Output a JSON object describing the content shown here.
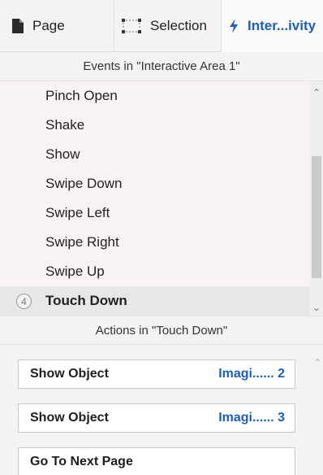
{
  "tabs": {
    "page": {
      "label": "Page",
      "icon": "page-icon"
    },
    "selection": {
      "label": "Selection",
      "icon": "selection-icon"
    },
    "interactivity": {
      "label": "Inter...ivity",
      "icon": "interactivity-icon",
      "active": true
    }
  },
  "events": {
    "header": "Events in \"Interactive Area 1\"",
    "items": [
      {
        "label": "Pinch Open"
      },
      {
        "label": "Shake"
      },
      {
        "label": "Show"
      },
      {
        "label": "Swipe Down"
      },
      {
        "label": "Swipe Left"
      },
      {
        "label": "Swipe Right"
      },
      {
        "label": "Swipe Up"
      },
      {
        "label": "Touch Down",
        "badge": "4",
        "selected": true
      }
    ]
  },
  "actions": {
    "header": "Actions in \"Touch Down\"",
    "items": [
      {
        "name": "Show Object",
        "target": "Imagi...... 2"
      },
      {
        "name": "Show Object",
        "target": "Imagi...... 3"
      },
      {
        "name": "Go To Next Page",
        "target": ""
      }
    ]
  },
  "colors": {
    "accent": "#1f5fb3",
    "list_background": "#f8f2f4",
    "selected_row": "#e9e6e9"
  }
}
